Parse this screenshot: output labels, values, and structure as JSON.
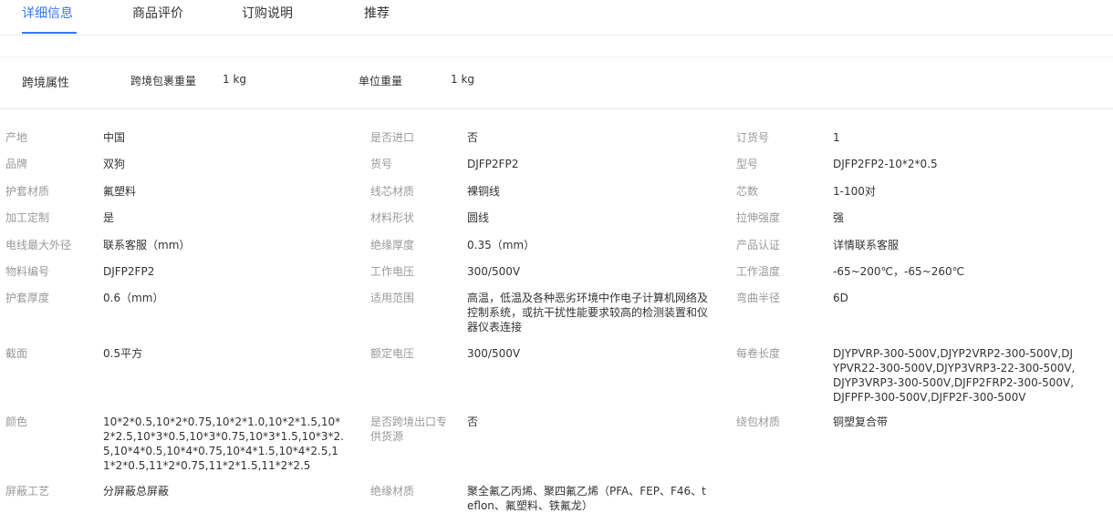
{
  "tabs": [
    {
      "label": "详细信息",
      "active": true
    },
    {
      "label": "商品评价",
      "active": false
    },
    {
      "label": "订购说明",
      "active": false
    },
    {
      "label": "推荐",
      "active": false
    }
  ],
  "cross_border": {
    "title": "跨境属性",
    "package_weight_label": "跨境包裹重量",
    "package_weight_value": "1 kg",
    "unit_weight_label": "单位重量",
    "unit_weight_value": "1 kg"
  },
  "attributes": {
    "col1": [
      {
        "label": "产地",
        "value": "中国"
      },
      {
        "label": "品牌",
        "value": "双狗"
      },
      {
        "label": "护套材质",
        "value": "氟塑料"
      },
      {
        "label": "加工定制",
        "value": "是"
      },
      {
        "label": "电线最大外径",
        "value": "联系客服（mm）"
      },
      {
        "label": "物料编号",
        "value": "DJFP2FP2"
      },
      {
        "label": "护套厚度",
        "value": "0.6（mm）"
      },
      {
        "label": "截面",
        "value": "0.5平方"
      },
      {
        "label": "颜色",
        "value": "10*2*0.5,10*2*0.75,10*2*1.0,10*2*1.5,10*2*2.5,10*3*0.5,10*3*0.75,10*3*1.5,10*3*2.5,10*4*0.5,10*4*0.75,10*4*1.5,10*4*2.5,11*2*0.5,11*2*0.75,11*2*1.5,11*2*2.5"
      },
      {
        "label": "屏蔽工艺",
        "value": "分屏蔽总屏蔽"
      }
    ],
    "col2": [
      {
        "label": "是否进口",
        "value": "否"
      },
      {
        "label": "货号",
        "value": "DJFP2FP2"
      },
      {
        "label": "线芯材质",
        "value": "裸铜线"
      },
      {
        "label": "材料形状",
        "value": "圆线"
      },
      {
        "label": "绝缘厚度",
        "value": "0.35（mm）"
      },
      {
        "label": "工作电压",
        "value": "300/500V"
      },
      {
        "label": "适用范围",
        "value": "高温，低温及各种恶劣环境中作电子计算机网络及控制系统，或抗干扰性能要求较高的检测装置和仪器仪表连接"
      },
      {
        "label": "额定电压",
        "value": "300/500V"
      },
      {
        "label": "是否跨境出口专供货源",
        "value": "否"
      },
      {
        "label": "绝缘材质",
        "value": "聚全氟乙丙烯、聚四氟乙烯（PFA、FEP、F46、teflon、氟塑料、铁氟龙）"
      }
    ],
    "col3": [
      {
        "label": "订货号",
        "value": "1"
      },
      {
        "label": "型号",
        "value": "DJFP2FP2-10*2*0.5"
      },
      {
        "label": "芯数",
        "value": "1-100对"
      },
      {
        "label": "拉伸强度",
        "value": "强"
      },
      {
        "label": "产品认证",
        "value": "详情联系客服"
      },
      {
        "label": "工作温度",
        "value": "-65~200℃，-65~260℃"
      },
      {
        "label": "弯曲半径",
        "value": "6D"
      },
      {
        "label": "每卷长度",
        "value": "DJYPVRP-300-500V,DJYP2VRP2-300-500V,DJYPVR22-300-500V,DJYP3VRP3-22-300-500V,DJYP3VRP3-300-500V,DJFP2FRP2-300-500V,DJFPFP-300-500V,DJFP2F-300-500V"
      },
      {
        "label": "绕包材质",
        "value": "铜塑复合带"
      }
    ]
  }
}
